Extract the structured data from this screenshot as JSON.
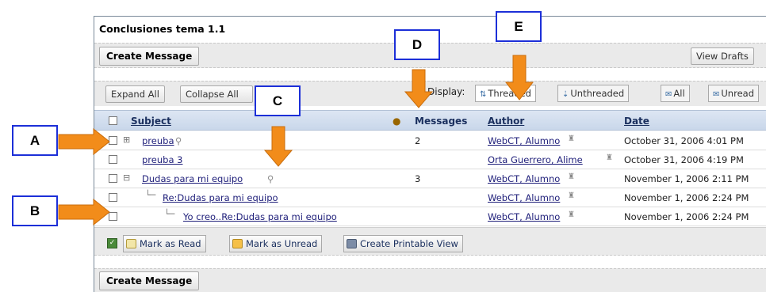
{
  "forum": {
    "title": "Conclusiones tema 1.1",
    "create_message": "Create Message",
    "view_drafts": "View Drafts",
    "expand_all": "Expand All",
    "collapse_all": "Collapse All",
    "display_label": "Display:",
    "threaded": "Threaded",
    "unthreaded": "Unthreaded",
    "all": "All",
    "unread": "Unread"
  },
  "table": {
    "headers": {
      "subject": "Subject",
      "messages": "Messages",
      "author": "Author",
      "date": "Date"
    },
    "rows": [
      {
        "subject": "preuba",
        "messages": "2",
        "author": "WebCT, Alumno",
        "date": "October 31, 2006 4:01 PM"
      },
      {
        "subject": "preuba 3",
        "messages": "",
        "author": "Orta Guerrero, Alime",
        "date": "October 31, 2006 4:19 PM"
      },
      {
        "subject": "Dudas para mi equipo",
        "messages": "3",
        "author": "WebCT, Alumno",
        "date": "November 1, 2006 2:11 PM"
      },
      {
        "subject": "Re:Dudas para mi equipo",
        "messages": "",
        "author": "WebCT, Alumno",
        "date": "November 1, 2006 2:24 PM"
      },
      {
        "subject": "Yo creo..Re:Dudas para mi equipo",
        "messages": "",
        "author": "WebCT, Alumno",
        "date": "November 1, 2006 2:24 PM"
      }
    ]
  },
  "actions": {
    "mark_read": "Mark as Read",
    "mark_unread": "Mark as Unread",
    "printable": "Create Printable View"
  },
  "callouts": {
    "a": "A",
    "b": "B",
    "c": "C",
    "d": "D",
    "e": "E"
  },
  "colors": {
    "callout_border": "#1c2fd8",
    "arrow": "#f28c1a",
    "header_bg": "#c9d7ea"
  },
  "icons": [
    "checkbox-icon",
    "expand-icon",
    "collapse-icon",
    "attachment-icon",
    "user-icon",
    "threaded-icon",
    "unthreaded-icon",
    "all-icon",
    "unread-icon",
    "mark-read-icon",
    "mark-unread-icon",
    "printer-icon",
    "select-all-icon",
    "unread-header-icon"
  ]
}
